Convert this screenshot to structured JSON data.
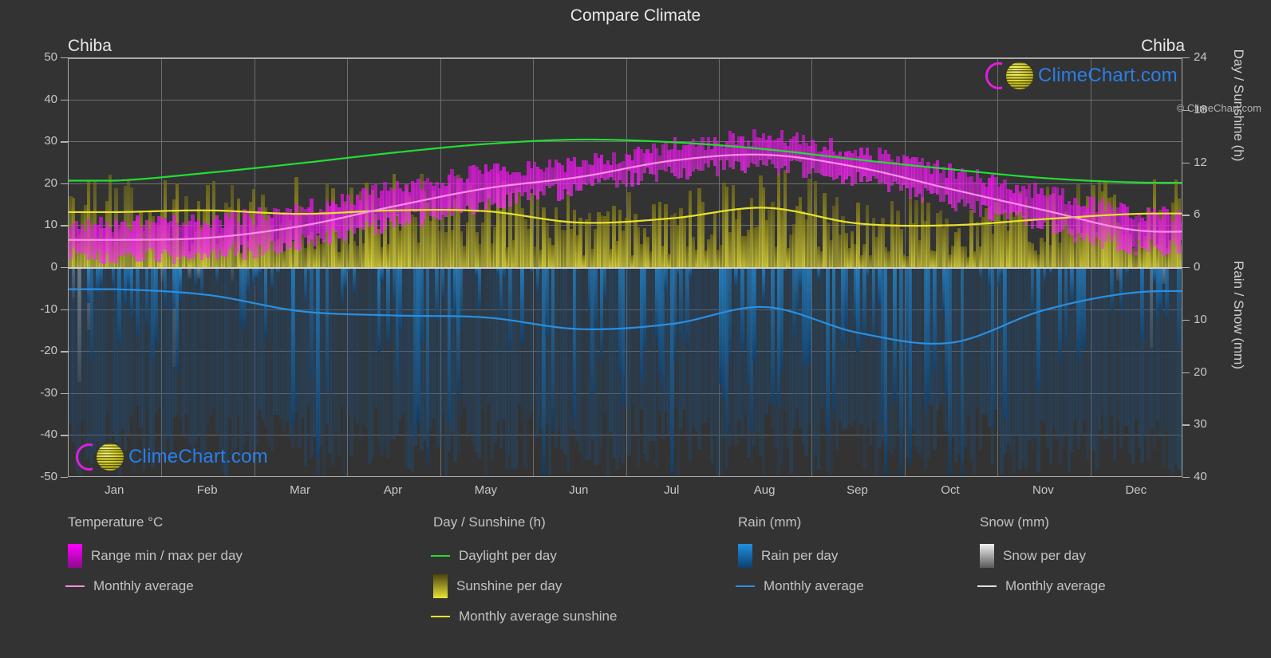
{
  "header": {
    "title": "Compare Climate",
    "location_left": "Chiba",
    "location_right": "Chiba"
  },
  "watermark": {
    "text": "ClimeChart.com"
  },
  "copyright": "© ClimeChart.com",
  "axes": {
    "left_label": "Temperature °C",
    "right_label_top": "Day / Sunshine (h)",
    "right_label_bottom": "Rain / Snow (mm)",
    "left_ticks": [
      "50",
      "40",
      "30",
      "20",
      "10",
      "0",
      "-10",
      "-20",
      "-30",
      "-40",
      "-50"
    ],
    "right_ticks_top": [
      "24",
      "18",
      "12",
      "6",
      "0"
    ],
    "right_ticks_bottom": [
      "0",
      "10",
      "20",
      "30",
      "40"
    ],
    "x_ticks": [
      "Jan",
      "Feb",
      "Mar",
      "Apr",
      "May",
      "Jun",
      "Jul",
      "Aug",
      "Sep",
      "Oct",
      "Nov",
      "Dec"
    ]
  },
  "legend": {
    "groups": [
      {
        "title": "Temperature °C",
        "items": [
          {
            "label": "Range min / max per day",
            "marker": "swatch",
            "color": "#ff00ff",
            "color2": "#8c0a8c"
          },
          {
            "label": "Monthly average",
            "marker": "line",
            "color": "#ff8ce8"
          }
        ]
      },
      {
        "title": "Day / Sunshine (h)",
        "items": [
          {
            "label": "Daylight per day",
            "marker": "line",
            "color": "#22dd33"
          },
          {
            "label": "Sunshine per day",
            "marker": "swatch",
            "color": "#4a4410",
            "color2": "#eae438"
          },
          {
            "label": "Monthly average sunshine",
            "marker": "line",
            "color": "#e8e22e"
          }
        ]
      },
      {
        "title": "Rain (mm)",
        "items": [
          {
            "label": "Rain per day",
            "marker": "swatch",
            "color": "#1f8fe0",
            "color2": "#0d3f6e"
          },
          {
            "label": "Monthly average",
            "marker": "line",
            "color": "#2a8fe0"
          }
        ]
      },
      {
        "title": "Snow (mm)",
        "items": [
          {
            "label": "Snow per day",
            "marker": "swatch",
            "color": "#f0f0f0",
            "color2": "#5a5a5a"
          },
          {
            "label": "Monthly average",
            "marker": "line",
            "color": "#e0e0e0"
          }
        ]
      }
    ]
  },
  "chart_data": {
    "type": "line",
    "title": "Compare Climate",
    "subtitle": "Chiba",
    "xlabel": "",
    "ylabel": "Temperature °C",
    "ylabel_right_top": "Day / Sunshine (h)",
    "ylabel_right_bottom": "Rain / Snow (mm)",
    "categories": [
      "Jan",
      "Feb",
      "Mar",
      "Apr",
      "May",
      "Jun",
      "Jul",
      "Aug",
      "Sep",
      "Oct",
      "Nov",
      "Dec"
    ],
    "ylim": [
      -50,
      50
    ],
    "ylim_right_top": [
      0,
      24
    ],
    "ylim_right_bottom": [
      0,
      40
    ],
    "grid": true,
    "legend_position": "below",
    "series": [
      {
        "name": "Monthly average temperature",
        "unit": "°C",
        "color": "#ff8ce8",
        "axis": "left",
        "values": [
          6.5,
          7.0,
          9.8,
          14.5,
          18.8,
          21.5,
          25.4,
          26.8,
          23.8,
          18.6,
          13.6,
          8.8
        ]
      },
      {
        "name": "Daily max temperature (range top)",
        "unit": "°C",
        "color": "#ff00ff",
        "axis": "left",
        "values": [
          10.2,
          10.8,
          13.8,
          18.6,
          22.6,
          25.0,
          28.8,
          30.6,
          27.4,
          22.4,
          17.6,
          12.8
        ]
      },
      {
        "name": "Daily min temperature (range bottom)",
        "unit": "°C",
        "color": "#ff00ff",
        "axis": "left",
        "values": [
          2.8,
          3.2,
          6.0,
          10.8,
          15.4,
          19.0,
          22.8,
          24.2,
          21.0,
          15.4,
          9.8,
          5.0
        ]
      },
      {
        "name": "Daylight per day",
        "unit": "h",
        "color": "#22dd33",
        "axis": "right_top",
        "values": [
          9.9,
          10.8,
          11.9,
          13.1,
          14.1,
          14.6,
          14.3,
          13.5,
          12.3,
          11.2,
          10.2,
          9.7
        ]
      },
      {
        "name": "Monthly average sunshine",
        "unit": "h",
        "color": "#e8e22e",
        "axis": "right_top",
        "values": [
          6.3,
          6.5,
          6.1,
          6.5,
          6.4,
          5.1,
          5.6,
          6.8,
          5.0,
          4.8,
          5.5,
          6.1
        ]
      },
      {
        "name": "Rain monthly average",
        "unit": "mm",
        "color": "#2a8fe0",
        "axis": "right_bottom",
        "values": [
          4.2,
          5.3,
          8.4,
          9.2,
          9.6,
          11.8,
          10.8,
          7.6,
          12.5,
          14.4,
          8.2,
          4.8
        ]
      }
    ],
    "notes": "Daily stochastic bars: temperature range (magenta), sunshine hours (yellow), rainfall (blue, plotted downward), snowfall (grey, plotted downward)."
  }
}
